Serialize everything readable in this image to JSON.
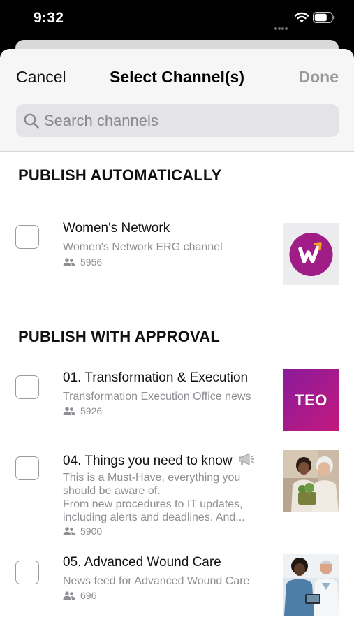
{
  "status_bar": {
    "time": "9:32"
  },
  "header": {
    "cancel_label": "Cancel",
    "title": "Select Channel(s)",
    "done_label": "Done"
  },
  "search": {
    "placeholder": "Search channels",
    "value": ""
  },
  "sections": [
    {
      "heading": "PUBLISH AUTOMATICALLY",
      "channels": [
        {
          "title": "Women's Network",
          "description": "Women's Network ERG channel",
          "members": "5956",
          "checked": false,
          "thumb": "women-network-logo"
        }
      ]
    },
    {
      "heading": "PUBLISH WITH APPROVAL",
      "channels": [
        {
          "title": "01. Transformation & Execution",
          "description": "Transformation Execution Office news",
          "members": "5926",
          "checked": false,
          "thumb": "teo-logo",
          "thumb_text": "TEO"
        },
        {
          "title": "04. Things you need to know",
          "description": "This is a Must-Have, everything you should be aware of.\nFrom new procedures to IT updates, including alerts and deadlines. And...",
          "members": "5900",
          "checked": false,
          "thumb": "photo-two-women",
          "title_icon": "megaphone-icon"
        },
        {
          "title": "05. Advanced Wound Care",
          "description": "News feed for Advanced Wound Care",
          "members": "696",
          "checked": false,
          "thumb": "photo-medical-staff"
        }
      ]
    }
  ],
  "colors": {
    "header_bg": "#f6f6f7",
    "done_disabled": "#9a9a9d",
    "secondary_text": "#8e8e93",
    "brand_purple": "#7a1fa2",
    "brand_magenta": "#c8197a"
  }
}
